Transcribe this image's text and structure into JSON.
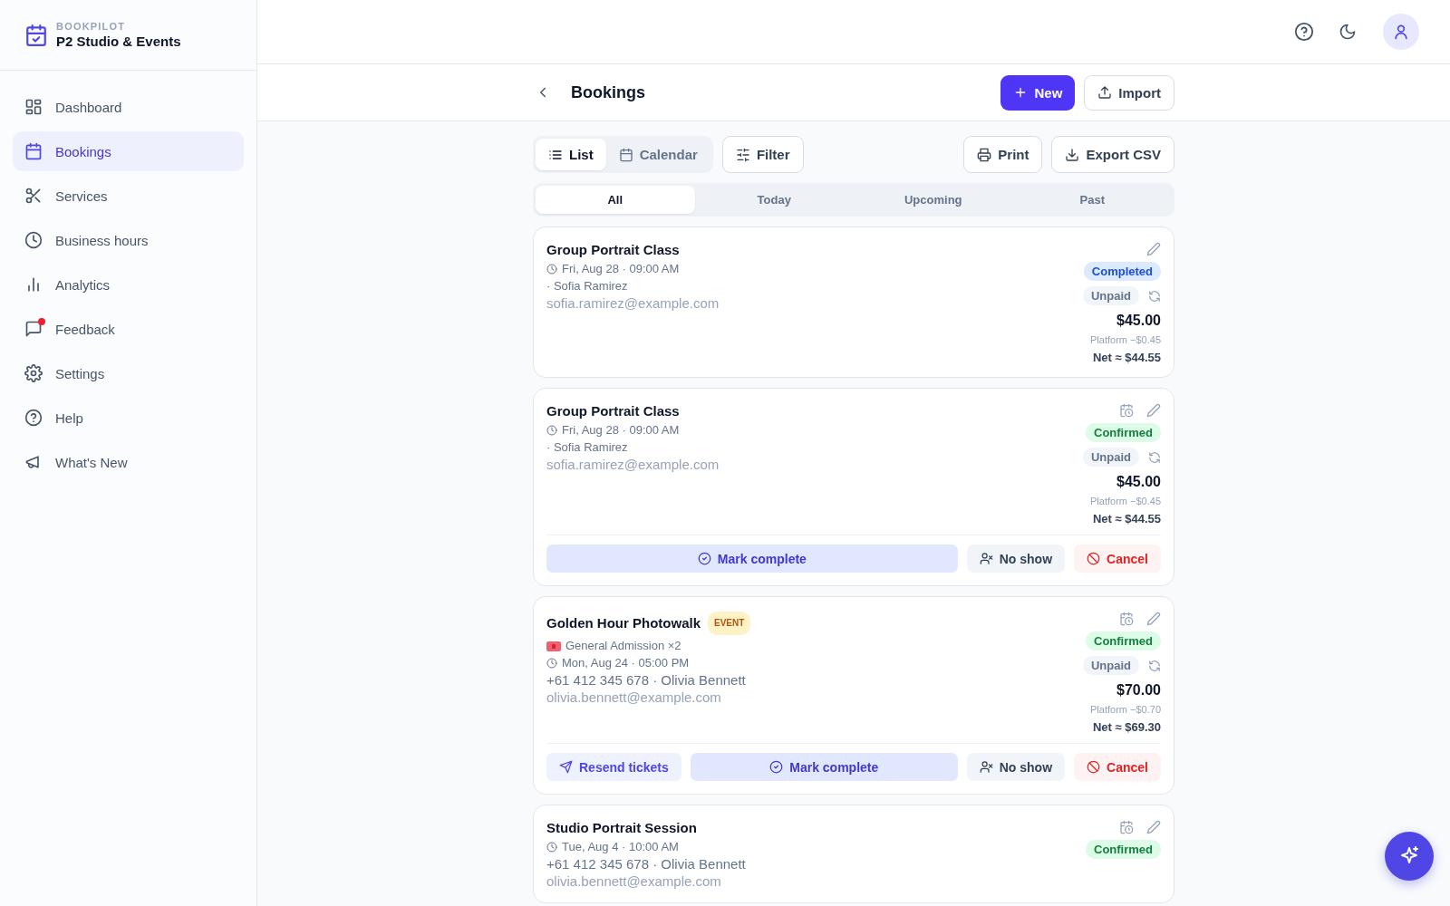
{
  "brand": {
    "app": "BOOKPILOT",
    "business": "P2 Studio & Events"
  },
  "sidebar": {
    "items": [
      {
        "label": "Dashboard",
        "selected": false,
        "unread": false
      },
      {
        "label": "Bookings",
        "selected": true,
        "unread": false
      },
      {
        "label": "Services",
        "selected": false,
        "unread": false
      },
      {
        "label": "Business hours",
        "selected": false,
        "unread": false
      },
      {
        "label": "Analytics",
        "selected": false,
        "unread": false
      },
      {
        "label": "Feedback",
        "selected": false,
        "unread": true
      },
      {
        "label": "Settings",
        "selected": false,
        "unread": false
      },
      {
        "label": "Help",
        "selected": false,
        "unread": false
      },
      {
        "label": "What's New",
        "selected": false,
        "unread": false
      }
    ]
  },
  "page": {
    "title": "Bookings",
    "primary_button": "New",
    "secondary_button": "Import"
  },
  "views": [
    {
      "label": "List",
      "selected": true
    },
    {
      "label": "Calendar",
      "selected": false
    }
  ],
  "filter_button": "Filter",
  "tools": [
    "Print",
    "Export CSV"
  ],
  "tabs": [
    {
      "label": "All",
      "selected": true
    },
    {
      "label": "Today",
      "selected": false
    },
    {
      "label": "Upcoming",
      "selected": false
    },
    {
      "label": "Past",
      "selected": false
    }
  ],
  "bookings": [
    {
      "title": "Group Portrait Class",
      "datetime": "Fri, Aug 28 · 09:00 AM",
      "contact": "· Sofia Ramirez",
      "email": "sofia.ramirez@example.com",
      "can_reschedule": false,
      "status": {
        "label": "Completed",
        "kind": "completed"
      },
      "payment": "Unpaid",
      "amount": "$45.00",
      "platform_fee": "Platform −$0.45",
      "net": "Net ≈ $44.55"
    },
    {
      "title": "Group Portrait Class",
      "datetime": "Fri, Aug 28 · 09:00 AM",
      "contact": "· Sofia Ramirez",
      "email": "sofia.ramirez@example.com",
      "can_reschedule": true,
      "status": {
        "label": "Confirmed",
        "kind": "confirmed"
      },
      "payment": "Unpaid",
      "amount": "$45.00",
      "platform_fee": "Platform −$0.45",
      "net": "Net ≈ $44.55",
      "actions": [
        {
          "label": "Mark complete",
          "kind": "complete"
        },
        {
          "label": "No show",
          "kind": "noshow"
        },
        {
          "label": "Cancel",
          "kind": "cancel"
        }
      ]
    },
    {
      "title": "Golden Hour Photowalk",
      "tag": "EVENT",
      "ticket": "General Admission ×2",
      "datetime": "Mon, Aug 24 · 05:00 PM",
      "contact": "+61 412 345 678 · Olivia Bennett",
      "email": "olivia.bennett@example.com",
      "can_reschedule": true,
      "status": {
        "label": "Confirmed",
        "kind": "confirmed"
      },
      "payment": "Unpaid",
      "amount": "$70.00",
      "platform_fee": "Platform −$0.70",
      "net": "Net ≈ $69.30",
      "actions": [
        {
          "label": "Resend tickets",
          "kind": "resend"
        },
        {
          "label": "Mark complete",
          "kind": "complete"
        },
        {
          "label": "No show",
          "kind": "noshow"
        },
        {
          "label": "Cancel",
          "kind": "cancel"
        }
      ]
    },
    {
      "title": "Studio Portrait Session",
      "datetime": "Tue, Aug 4 · 10:00 AM",
      "contact": "+61 412 345 678 · Olivia Bennett",
      "email": "olivia.bennett@example.com",
      "can_reschedule": true,
      "status": {
        "label": "Confirmed",
        "kind": "confirmed"
      }
    }
  ]
}
